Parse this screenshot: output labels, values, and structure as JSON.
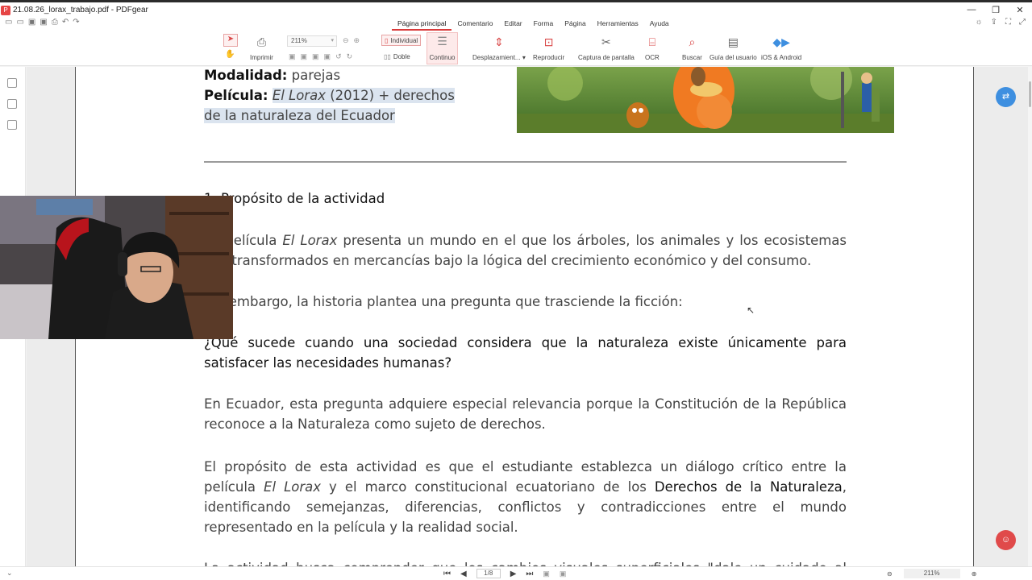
{
  "window": {
    "title": "21.08.26_lorax_trabajo.pdf - PDFgear",
    "controls": [
      "—",
      "❐",
      "✕"
    ]
  },
  "menu": {
    "tabs": [
      "Página principal",
      "Comentario",
      "Editar",
      "Forma",
      "Página",
      "Herramientas",
      "Ayuda"
    ],
    "active": "Página principal"
  },
  "toolbar": {
    "print_label": "Imprimir",
    "zoom_value": "211%",
    "individual_label": "Individual",
    "doble_label": "Doble",
    "continuo_label": "Continuo",
    "desplazamiento_label": "Desplazamient...",
    "reproducir_label": "Reproducir",
    "captura_label": "Captura de pantalla",
    "ocr_label": "OCR",
    "buscar_label": "Buscar",
    "guia_label": "Guía del usuario",
    "ios_label": "iOS & Android"
  },
  "document": {
    "modalidad_label": "Modalidad:",
    "modalidad_value": " parejas",
    "pelicula_label": "Película:",
    "pelicula_title": "El Lorax",
    "pelicula_rest": " (2012) + derechos de la naturaleza del Ecuador",
    "section_title": "1. Propósito de la actividad",
    "p1_a": "La película ",
    "p1_em": "El Lorax",
    "p1_b": " presenta un mundo en el que los árboles, los animales y los ecosistemas son transformados en mercancías bajo la lógica del crecimiento económico y del consumo.",
    "p2": "Sin embargo, la historia plantea una pregunta que trasciende la ficción:",
    "p3": "¿Qué sucede cuando una sociedad considera que la naturaleza existe únicamente para satisfacer las necesidades humanas?",
    "p4": "En Ecuador, esta pregunta adquiere especial relevancia porque la Constitución de la República reconoce a la Naturaleza como sujeto de derechos.",
    "p5_a": "El propósito de esta actividad es que el estudiante establezca un diálogo crítico entre la película ",
    "p5_em": "El Lorax",
    "p5_b": " y el marco constitucional ecuatoriano de los ",
    "p5_strong": "Derechos de la Naturaleza",
    "p5_c": ", identificando semejanzas, diferencias, conflictos y contradicciones entre el mundo representado en la película y la realidad social.",
    "p6": "La actividad busca comprender que los cambios visuales superficiales \"dale un cuidado al árbol\"..."
  },
  "status": {
    "page_indicator": "1/8",
    "zoom": "211%"
  },
  "colors": {
    "accent": "#d93a3a",
    "translate_button": "#3e8fe0",
    "highlight": "#dbe4ef"
  }
}
